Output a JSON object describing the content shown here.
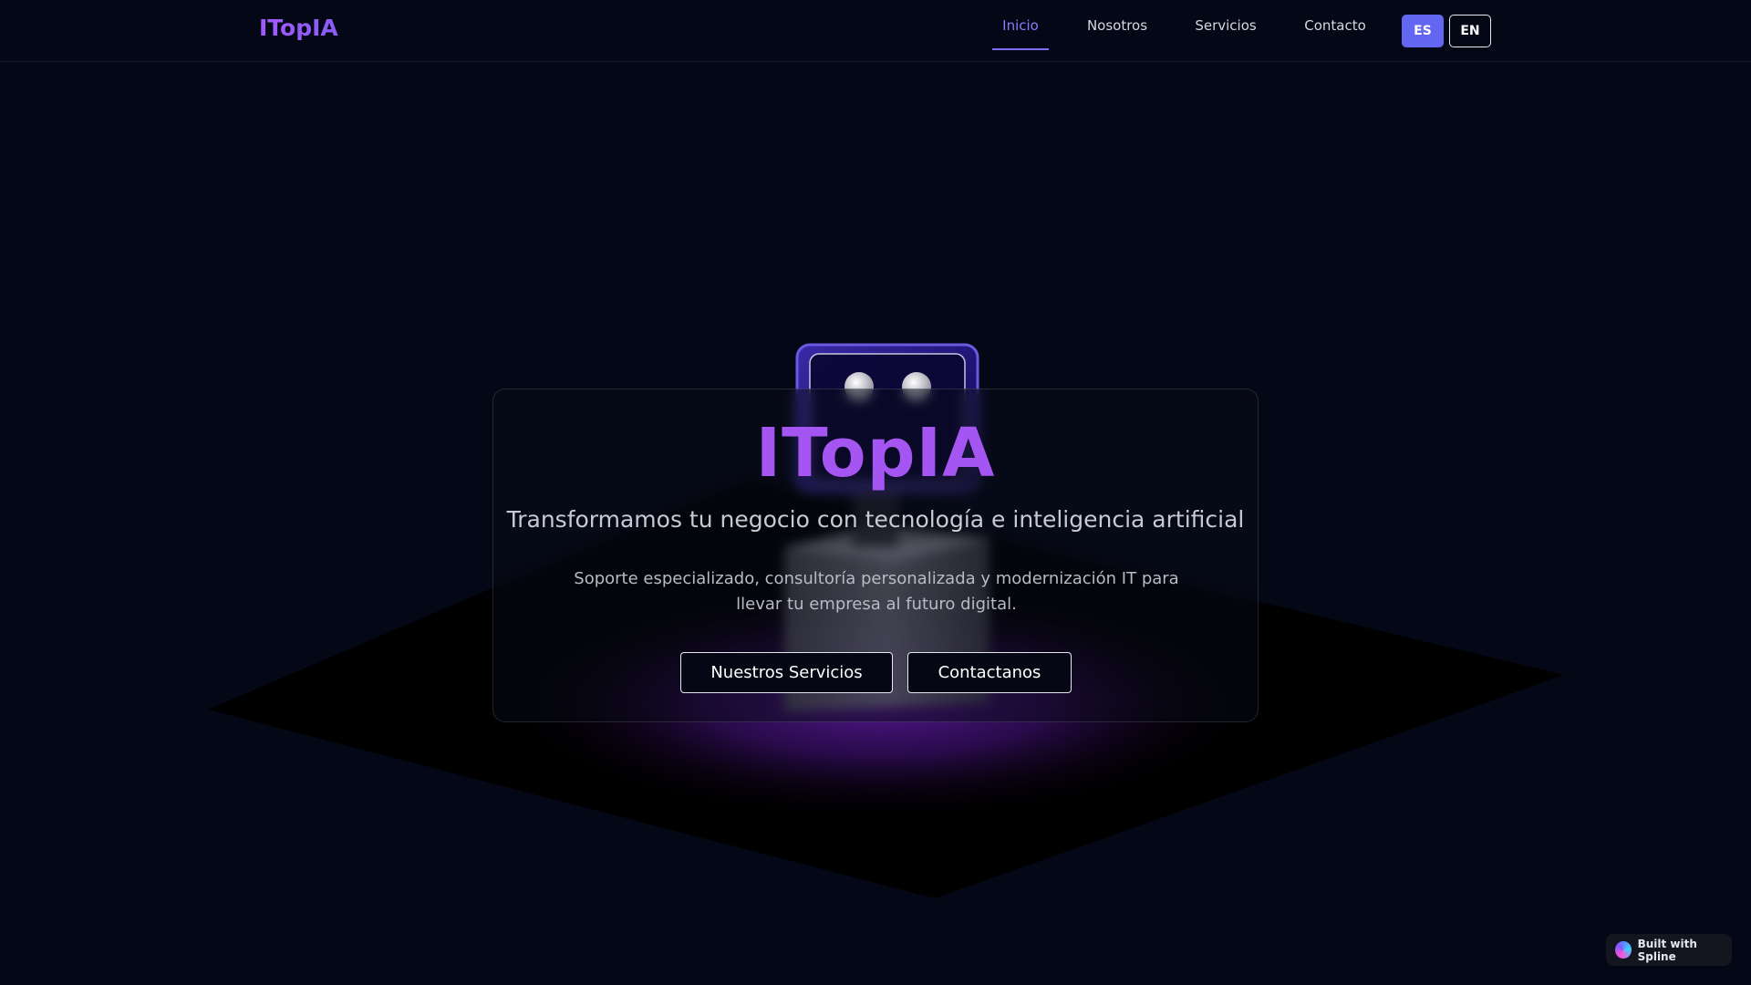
{
  "nav": {
    "logo": "ITopIA",
    "links": [
      "Inicio",
      "Nosotros",
      "Servicios",
      "Contacto"
    ],
    "active_link": "Inicio",
    "lang_es": "ES",
    "lang_en": "EN",
    "active_lang": "ES"
  },
  "hero": {
    "title": "ITopIA",
    "subtitle": "Transformamos tu negocio con tecnología e inteligencia artificial",
    "description": "Soporte especializado, consultoría personalizada y modernización IT para llevar tu empresa al futuro digital.",
    "primary_button": "Nuestros Servicios",
    "secondary_button": "Contactanos"
  },
  "badge": {
    "label": "Built with Spline",
    "icon": "spline-logo-icon"
  },
  "colors": {
    "background": "#040816",
    "accent": "#a556f2",
    "nav_active": "#8b7bff",
    "lang_active_bg": "#6366f1"
  }
}
